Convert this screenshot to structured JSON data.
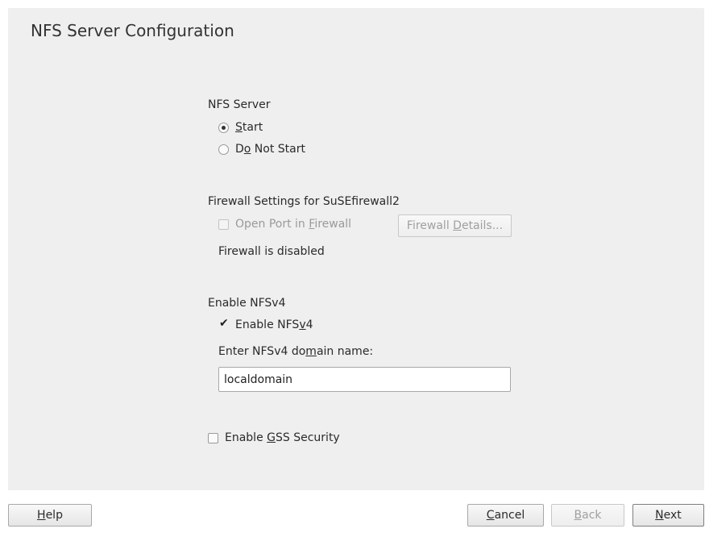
{
  "title": "NFS Server Configuration",
  "nfs_server": {
    "label": "NFS Server",
    "start": {
      "pre": "",
      "mnemonic": "S",
      "post": "tart",
      "selected": true
    },
    "do_not_start": {
      "pre": "D",
      "mnemonic": "o",
      "post": " Not Start",
      "selected": false
    }
  },
  "firewall": {
    "label": "Firewall Settings for SuSEfirewall2",
    "open_port": {
      "pre": "Open Port in ",
      "mnemonic": "F",
      "post": "irewall",
      "checked": false,
      "enabled": false
    },
    "details_button": {
      "pre": "Firewall ",
      "mnemonic": "D",
      "post": "etails...",
      "enabled": false
    },
    "status": "Firewall is disabled"
  },
  "nfsv4": {
    "label": "Enable NFSv4",
    "enable": {
      "pre": "Enable NFS",
      "mnemonic": "v",
      "post": "4",
      "checked": true
    },
    "domain_label": {
      "pre": "Enter NFSv4 do",
      "mnemonic": "m",
      "post": "ain name:"
    },
    "domain_value": "localdomain"
  },
  "gss": {
    "enable": {
      "pre": "Enable ",
      "mnemonic": "G",
      "post": "SS Security",
      "checked": false
    }
  },
  "footer": {
    "help": {
      "pre": "",
      "mnemonic": "H",
      "post": "elp"
    },
    "cancel": {
      "pre": "",
      "mnemonic": "C",
      "post": "ancel"
    },
    "back": {
      "pre": "",
      "mnemonic": "B",
      "post": "ack",
      "enabled": false
    },
    "next": {
      "pre": "",
      "mnemonic": "N",
      "post": "ext"
    }
  }
}
